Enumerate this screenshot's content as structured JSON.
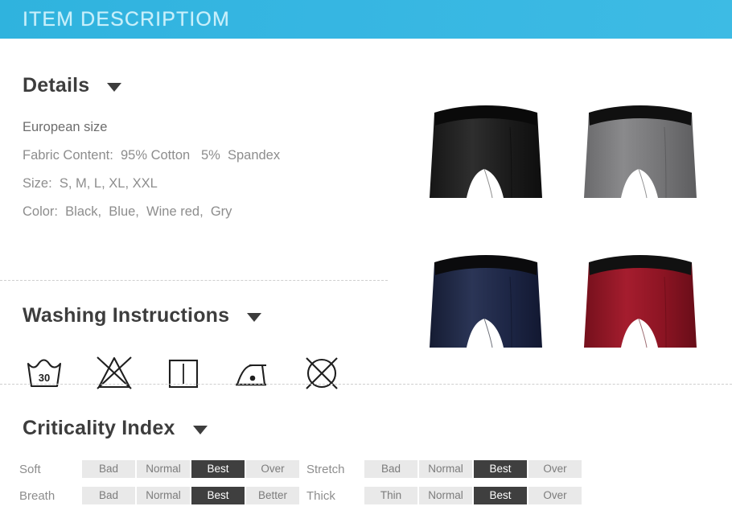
{
  "banner": {
    "title": "ITEM DESCRIPTIOM",
    "background_color": "#35b5e0",
    "text_color": "#c9f0fb"
  },
  "details": {
    "heading": "Details",
    "caret_icon": "chevron-down-icon",
    "lines": [
      "European size",
      "Fabric Content:  95% Cotton   5%  Spandex",
      "Size:  S, M, L, XL, XXL",
      "Color:  Black,  Blue,  Wine red,  Gry"
    ],
    "european_size": "European size",
    "fabric_label": "Fabric Content:",
    "fabric_value": "95% Cotton   5%  Spandex",
    "size_label": "Size:",
    "size_value": "S, M, L, XL, XXL",
    "color_label": "Color:",
    "color_value": "Black,  Blue,  Wine red,  Gry"
  },
  "washing": {
    "heading": "Washing Instructions",
    "caret_icon": "chevron-down-icon",
    "icons": [
      {
        "name": "wash-tub-30-icon",
        "label": "30"
      },
      {
        "name": "do-not-bleach-icon",
        "label": ""
      },
      {
        "name": "drip-dry-icon",
        "label": ""
      },
      {
        "name": "iron-low-heat-icon",
        "label": ""
      },
      {
        "name": "do-not-dry-clean-icon",
        "label": ""
      }
    ]
  },
  "criticality": {
    "heading": "Criticality Index",
    "caret_icon": "chevron-down-icon",
    "left_rows": [
      {
        "label": "Soft",
        "cells": [
          "Bad",
          "Normal",
          "Best",
          "Over"
        ],
        "active": 2
      },
      {
        "label": "Breath",
        "cells": [
          "Bad",
          "Normal",
          "Best",
          "Better"
        ],
        "active": 2
      }
    ],
    "right_rows": [
      {
        "label": "Stretch",
        "cells": [
          "Bad",
          "Normal",
          "Best",
          "Over"
        ],
        "active": 2
      },
      {
        "label": "Thick",
        "cells": [
          "Thin",
          "Normal",
          "Best",
          "Over"
        ],
        "active": 2
      }
    ],
    "cell_color": "#e9e9e9",
    "active_color": "#3f3f3f"
  },
  "products": [
    {
      "name": "boxer-black",
      "color": "#1c1c1c",
      "shade": "#303030",
      "waist": "#0c0c0c"
    },
    {
      "name": "boxer-gray",
      "color": "#6e6e70",
      "shade": "#868688",
      "waist": "#111111"
    },
    {
      "name": "boxer-navy",
      "color": "#1a2340",
      "shade": "#2a3556",
      "waist": "#0b0b0d"
    },
    {
      "name": "boxer-winered",
      "color": "#8c1423",
      "shade": "#a41c2d",
      "waist": "#111111"
    }
  ]
}
